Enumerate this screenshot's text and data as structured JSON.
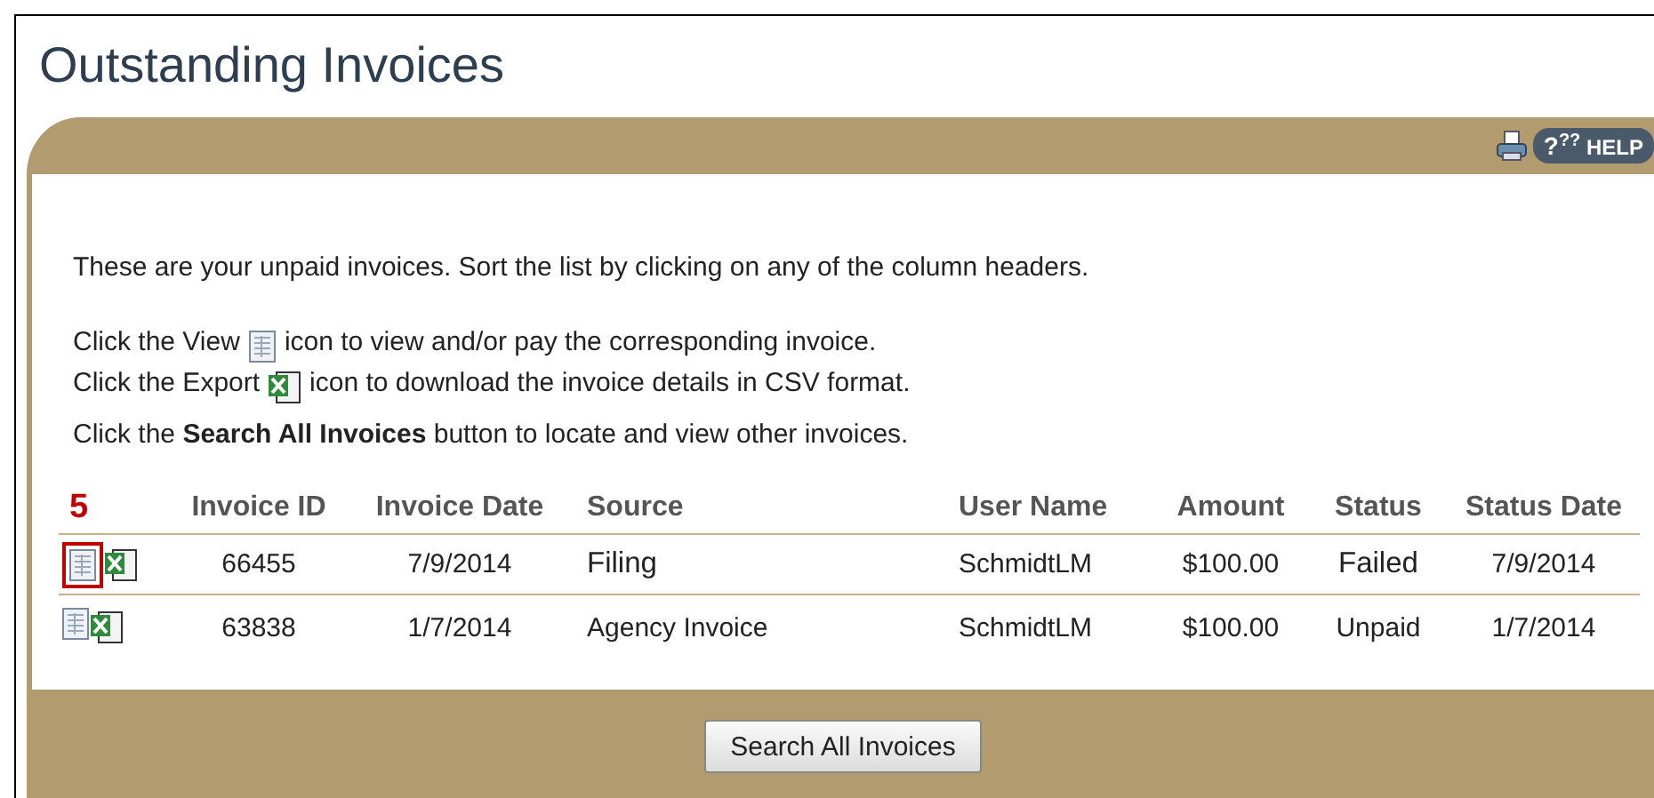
{
  "title": "Outstanding Invoices",
  "toolbar": {
    "help": {
      "glyph": "?",
      "glyph_small": "??",
      "label": "HELP"
    }
  },
  "intro": "These are your unpaid invoices. Sort the list by clicking on any of the column headers.",
  "icon_lines": [
    {
      "kind": "view",
      "before": "Click the View",
      "after": "icon to view and/or pay the corresponding invoice."
    },
    {
      "kind": "export",
      "before": "Click the Export",
      "after": "icon to download the invoice details in CSV format."
    }
  ],
  "search_hint": "Click the **Search All Invoices** button to locate and view other invoices.",
  "table": {
    "columns": [
      "Invoice ID",
      "Invoice Date",
      "Source",
      "User Name",
      "Amount",
      "Status",
      "Status Date"
    ],
    "rows": [
      {
        "callout": "5",
        "cells": [
          "66455",
          "7/9/2014",
          "Filing",
          "SchmidtLM",
          "$100.00",
          "Failed",
          "7/9/2014"
        ]
      },
      {
        "cells": [
          "63838",
          "1/7/2014",
          "Agency Invoice",
          "SchmidtLM",
          "$100.00",
          "Unpaid",
          "1/7/2014"
        ]
      }
    ]
  },
  "search_button": "Search All Invoices"
}
